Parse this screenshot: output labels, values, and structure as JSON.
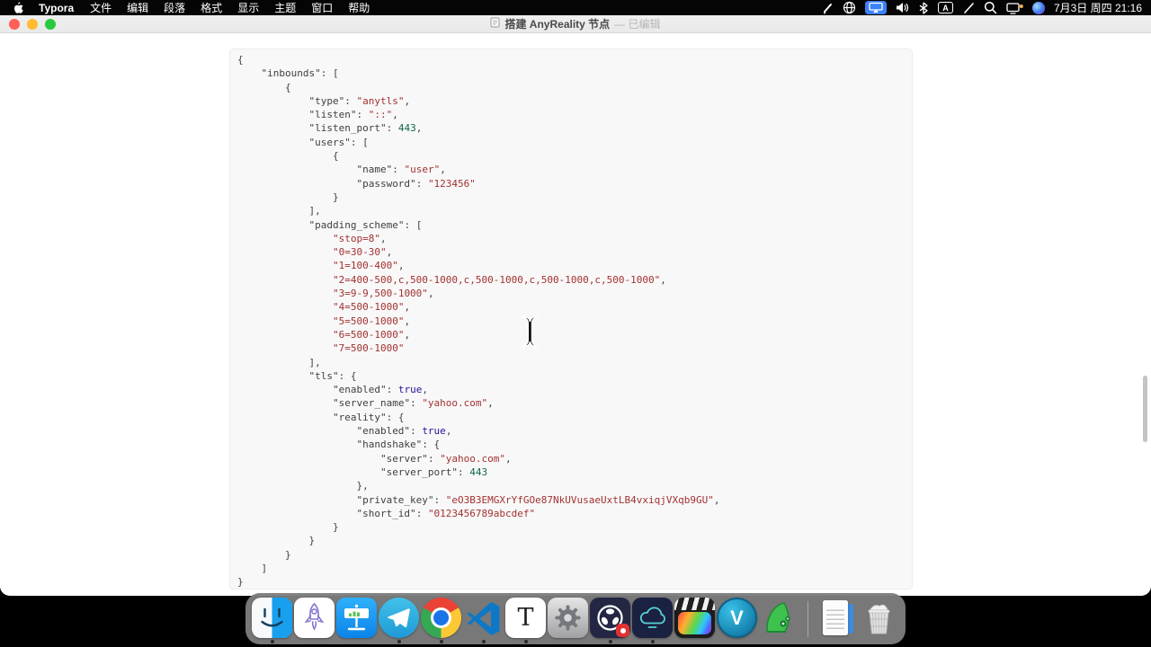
{
  "menubar": {
    "app_name": "Typora",
    "menus": [
      "文件",
      "编辑",
      "段落",
      "格式",
      "显示",
      "主题",
      "窗口",
      "帮助"
    ],
    "status_icons": [
      "pen-icon",
      "globe-icon",
      "screen-mirroring-icon",
      "volume-icon",
      "bluetooth-icon",
      "input-source-icon",
      "pencil-icon",
      "search-icon",
      "display-status-icon",
      "siri-icon"
    ],
    "input_source_glyph": "A",
    "datetime": "7月3日 周四 21:16"
  },
  "window": {
    "title": "搭建 AnyReality 节点",
    "edited_badge": "— 已编辑",
    "traffic_lights": {
      "close": "#ff5f57",
      "minimize": "#febc2e",
      "zoom": "#28c840"
    }
  },
  "code": {
    "language": "json",
    "background": "#f8f8f8",
    "token_colors": {
      "plain": "#3f3f3f",
      "key": "#3f3f3f",
      "string": "#a33131",
      "number": "#116644",
      "atom": "#221199"
    },
    "lines": [
      [
        [
          "p",
          "{"
        ]
      ],
      [
        [
          "p",
          "    "
        ],
        [
          "k",
          "\"inbounds\""
        ],
        [
          "p",
          ": ["
        ]
      ],
      [
        [
          "p",
          "        {"
        ]
      ],
      [
        [
          "p",
          "            "
        ],
        [
          "k",
          "\"type\""
        ],
        [
          "p",
          ": "
        ],
        [
          "s",
          "\"anytls\""
        ],
        [
          "p",
          ","
        ]
      ],
      [
        [
          "p",
          "            "
        ],
        [
          "k",
          "\"listen\""
        ],
        [
          "p",
          ": "
        ],
        [
          "s",
          "\"::\""
        ],
        [
          "p",
          ","
        ]
      ],
      [
        [
          "p",
          "            "
        ],
        [
          "k",
          "\"listen_port\""
        ],
        [
          "p",
          ": "
        ],
        [
          "n",
          "443"
        ],
        [
          "p",
          ","
        ]
      ],
      [
        [
          "p",
          "            "
        ],
        [
          "k",
          "\"users\""
        ],
        [
          "p",
          ": ["
        ]
      ],
      [
        [
          "p",
          "                {"
        ]
      ],
      [
        [
          "p",
          "                    "
        ],
        [
          "k",
          "\"name\""
        ],
        [
          "p",
          ": "
        ],
        [
          "s",
          "\"user\""
        ],
        [
          "p",
          ","
        ]
      ],
      [
        [
          "p",
          "                    "
        ],
        [
          "k",
          "\"password\""
        ],
        [
          "p",
          ": "
        ],
        [
          "s",
          "\"123456\""
        ]
      ],
      [
        [
          "p",
          "                }"
        ]
      ],
      [
        [
          "p",
          "            ],"
        ]
      ],
      [
        [
          "p",
          "            "
        ],
        [
          "k",
          "\"padding_scheme\""
        ],
        [
          "p",
          ": ["
        ]
      ],
      [
        [
          "p",
          "                "
        ],
        [
          "s",
          "\"stop=8\""
        ],
        [
          "p",
          ","
        ]
      ],
      [
        [
          "p",
          "                "
        ],
        [
          "s",
          "\"0=30-30\""
        ],
        [
          "p",
          ","
        ]
      ],
      [
        [
          "p",
          "                "
        ],
        [
          "s",
          "\"1=100-400\""
        ],
        [
          "p",
          ","
        ]
      ],
      [
        [
          "p",
          "                "
        ],
        [
          "s",
          "\"2=400-500,c,500-1000,c,500-1000,c,500-1000,c,500-1000\""
        ],
        [
          "p",
          ","
        ]
      ],
      [
        [
          "p",
          "                "
        ],
        [
          "s",
          "\"3=9-9,500-1000\""
        ],
        [
          "p",
          ","
        ]
      ],
      [
        [
          "p",
          "                "
        ],
        [
          "s",
          "\"4=500-1000\""
        ],
        [
          "p",
          ","
        ]
      ],
      [
        [
          "p",
          "                "
        ],
        [
          "s",
          "\"5=500-1000\""
        ],
        [
          "p",
          ","
        ]
      ],
      [
        [
          "p",
          "                "
        ],
        [
          "s",
          "\"6=500-1000\""
        ],
        [
          "p",
          ","
        ]
      ],
      [
        [
          "p",
          "                "
        ],
        [
          "s",
          "\"7=500-1000\""
        ]
      ],
      [
        [
          "p",
          "            ],"
        ]
      ],
      [
        [
          "p",
          "            "
        ],
        [
          "k",
          "\"tls\""
        ],
        [
          "p",
          ": {"
        ]
      ],
      [
        [
          "p",
          "                "
        ],
        [
          "k",
          "\"enabled\""
        ],
        [
          "p",
          ": "
        ],
        [
          "a",
          "true"
        ],
        [
          "p",
          ","
        ]
      ],
      [
        [
          "p",
          "                "
        ],
        [
          "k",
          "\"server_name\""
        ],
        [
          "p",
          ": "
        ],
        [
          "s",
          "\"yahoo.com\""
        ],
        [
          "p",
          ","
        ]
      ],
      [
        [
          "p",
          "                "
        ],
        [
          "k",
          "\"reality\""
        ],
        [
          "p",
          ": {"
        ]
      ],
      [
        [
          "p",
          "                    "
        ],
        [
          "k",
          "\"enabled\""
        ],
        [
          "p",
          ": "
        ],
        [
          "a",
          "true"
        ],
        [
          "p",
          ","
        ]
      ],
      [
        [
          "p",
          "                    "
        ],
        [
          "k",
          "\"handshake\""
        ],
        [
          "p",
          ": {"
        ]
      ],
      [
        [
          "p",
          "                        "
        ],
        [
          "k",
          "\"server\""
        ],
        [
          "p",
          ": "
        ],
        [
          "s",
          "\"yahoo.com\""
        ],
        [
          "p",
          ","
        ]
      ],
      [
        [
          "p",
          "                        "
        ],
        [
          "k",
          "\"server_port\""
        ],
        [
          "p",
          ": "
        ],
        [
          "n",
          "443"
        ]
      ],
      [
        [
          "p",
          "                    },"
        ]
      ],
      [
        [
          "p",
          "                    "
        ],
        [
          "k",
          "\"private_key\""
        ],
        [
          "p",
          ": "
        ],
        [
          "s",
          "\"eO3B3EMGXrYfGOe87NkUVusaeUxtLB4vxiqjVXqb9GU\""
        ],
        [
          "p",
          ","
        ]
      ],
      [
        [
          "p",
          "                    "
        ],
        [
          "k",
          "\"short_id\""
        ],
        [
          "p",
          ": "
        ],
        [
          "s",
          "\"0123456789abcdef\""
        ]
      ],
      [
        [
          "p",
          "                }"
        ]
      ],
      [
        [
          "p",
          "            }"
        ]
      ],
      [
        [
          "p",
          "        }"
        ]
      ],
      [
        [
          "p",
          "    ]"
        ]
      ],
      [
        [
          "p",
          "}"
        ]
      ]
    ]
  },
  "cursor": {
    "type": "i-beam-text-pointer"
  },
  "dock": {
    "background": "#7d7d7d",
    "glyphs": {
      "typora": "T",
      "v2rayu": "V"
    },
    "apps": [
      {
        "id": "finder",
        "name": "Finder",
        "running": true
      },
      {
        "id": "rocket",
        "name": "Rocket App",
        "running": false
      },
      {
        "id": "keynote",
        "name": "Keynote",
        "running": false
      },
      {
        "id": "telegram",
        "name": "Telegram",
        "running": true
      },
      {
        "id": "chrome",
        "name": "Google Chrome",
        "running": true
      },
      {
        "id": "vscode",
        "name": "VS Code",
        "running": true
      },
      {
        "id": "typora",
        "name": "Typora",
        "running": true
      },
      {
        "id": "settings",
        "name": "System Settings",
        "running": false
      },
      {
        "id": "obs",
        "name": "OBS Studio",
        "running": true
      },
      {
        "id": "cloudterm",
        "name": "Cloud Terminal",
        "running": true
      },
      {
        "id": "fcp",
        "name": "Final Cut Pro",
        "running": false
      },
      {
        "id": "v2rayu",
        "name": "V2RayU",
        "running": false
      },
      {
        "id": "wireshark",
        "name": "Wireshark",
        "running": false
      },
      {
        "id": "documents",
        "name": "Documents",
        "running": false
      },
      {
        "id": "trash",
        "name": "Trash",
        "running": false
      }
    ]
  }
}
